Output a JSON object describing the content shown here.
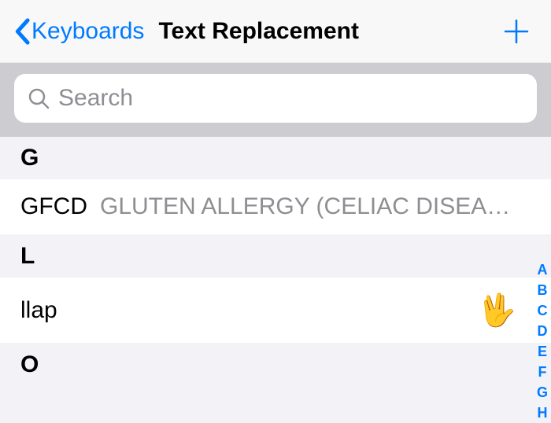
{
  "header": {
    "back_label": "Keyboards",
    "title": "Text Replacement"
  },
  "search": {
    "placeholder": "Search"
  },
  "sections": {
    "g": {
      "header": "G",
      "row": {
        "shortcut": "GFCD",
        "phrase": "GLUTEN ALLERGY (CELIAC DISEA…"
      }
    },
    "l": {
      "header": "L",
      "row": {
        "shortcut": "llap",
        "phrase": "🖖"
      }
    },
    "o": {
      "header": "O"
    }
  },
  "index": {
    "a": "A",
    "b": "B",
    "c": "C",
    "d": "D",
    "e": "E",
    "f": "F",
    "g": "G",
    "h": "H"
  }
}
